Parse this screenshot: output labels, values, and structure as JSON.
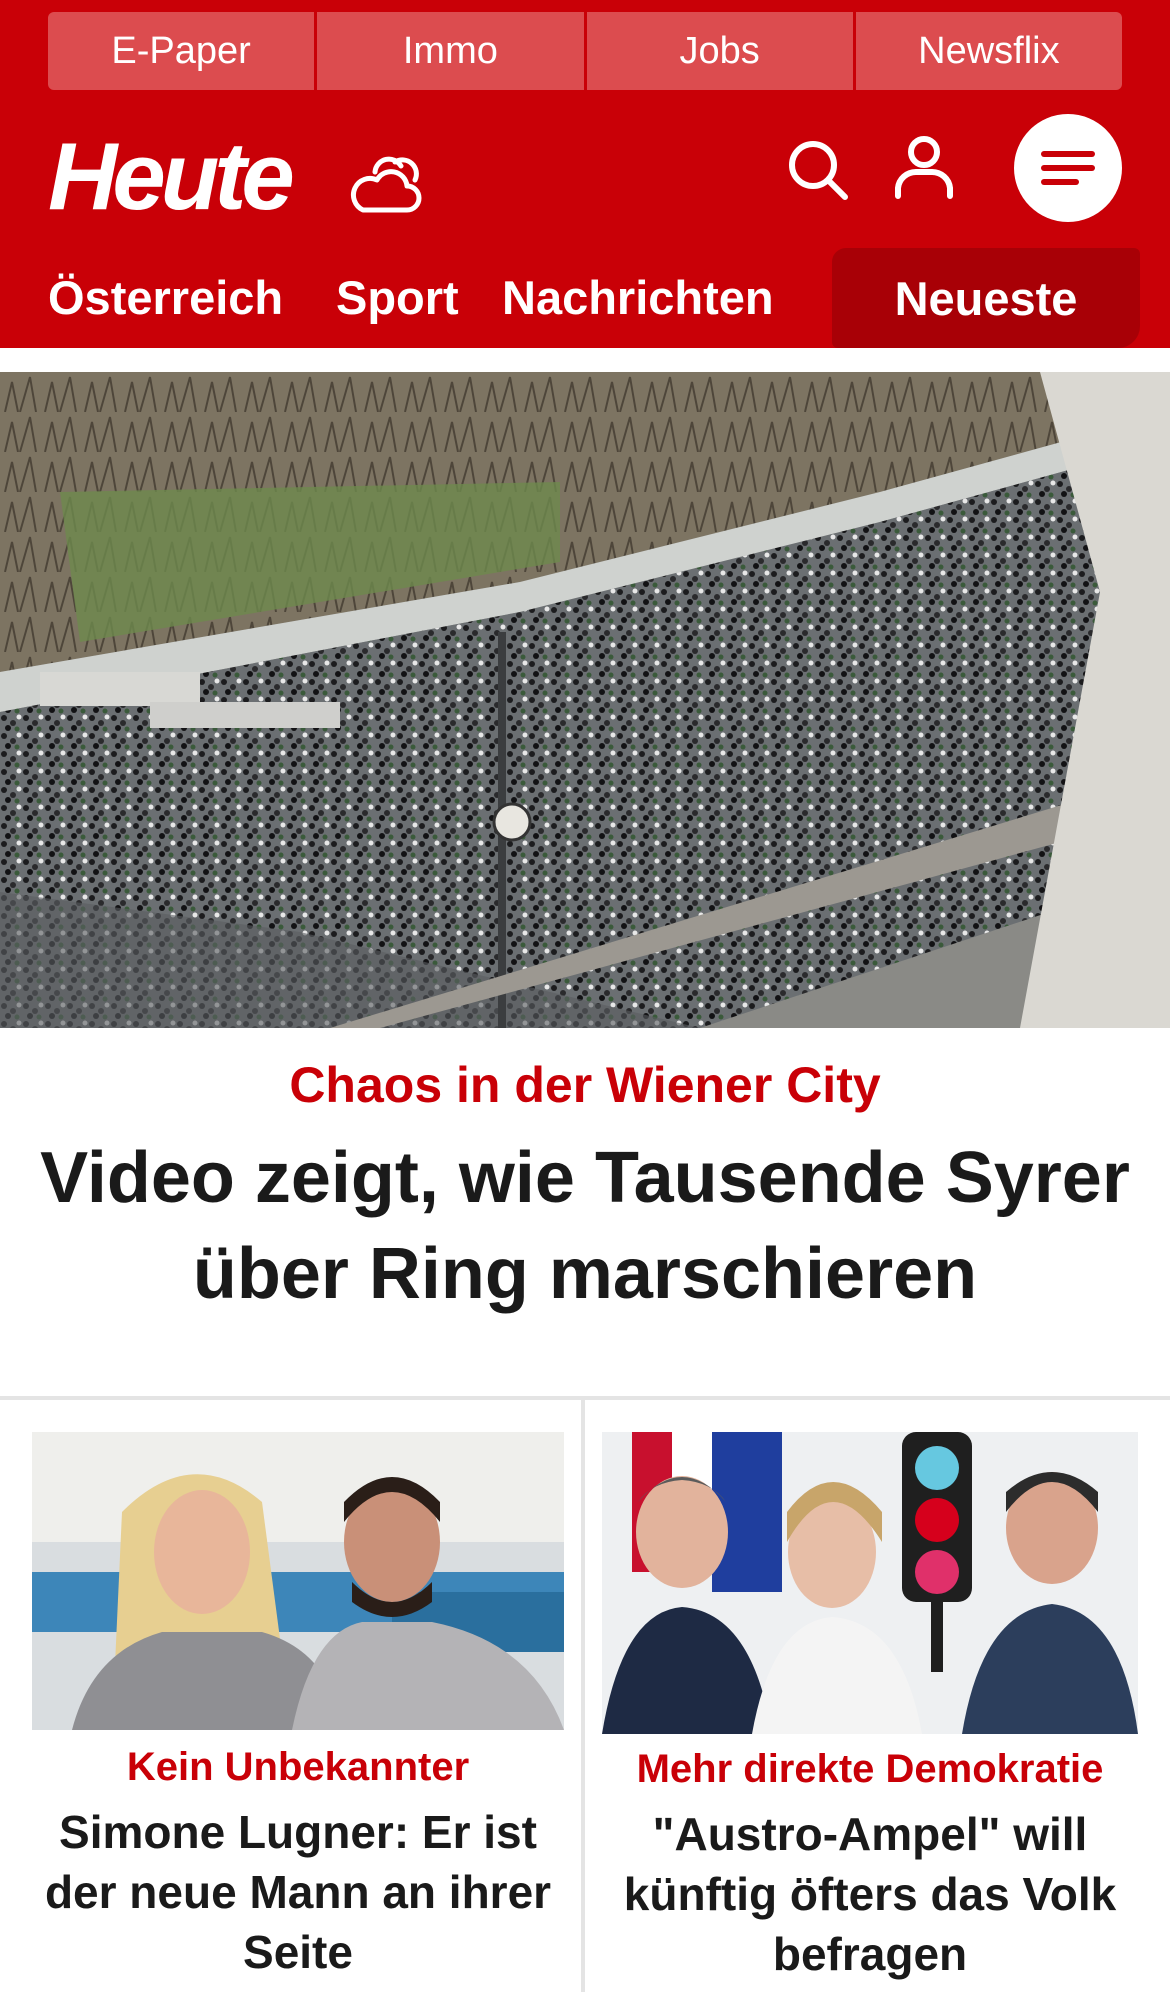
{
  "top_nav": [
    "E-Paper",
    "Immo",
    "Jobs",
    "Newsflix"
  ],
  "brand": {
    "logo": "Heute",
    "color": "#c90007"
  },
  "icons": {
    "weather": "cloud-sun-icon",
    "search": "search-icon",
    "account": "user-icon",
    "menu": "hamburger-menu-icon"
  },
  "section_nav": {
    "items": [
      "Österreich",
      "Sport",
      "Nachrichten"
    ],
    "highlight": "Neueste"
  },
  "hero": {
    "kicker": "Chaos in der Wiener City",
    "title": "Video zeigt, wie Tausende Syrer über Ring marschieren"
  },
  "cards": [
    {
      "kicker": "Kein Unbekannter",
      "title": "Simone Lugner: Er ist der neue Mann an ihrer Seite"
    },
    {
      "kicker": "Mehr direkte Demokratie",
      "title": "\"Austro-Ampel\" will künftig öfters das Volk befragen"
    }
  ]
}
